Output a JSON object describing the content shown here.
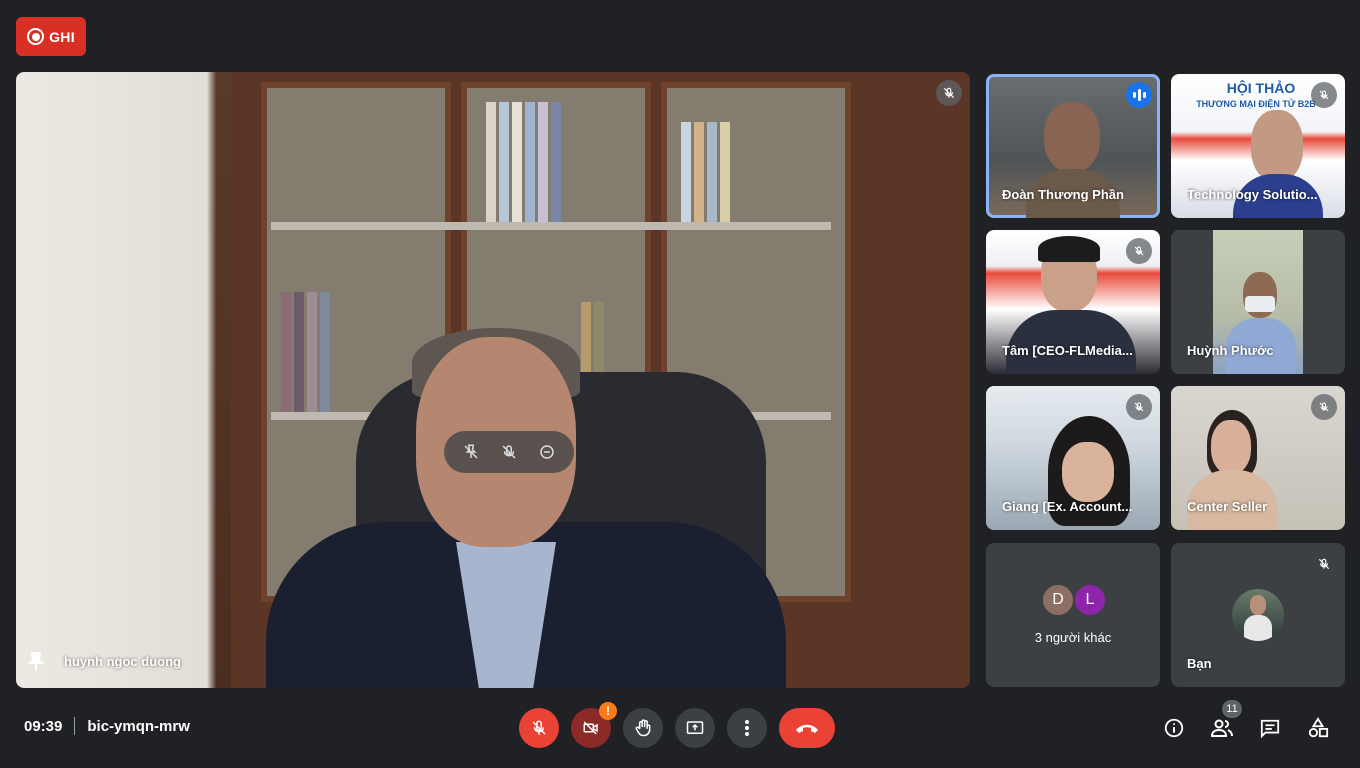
{
  "recording": {
    "label": "GHI",
    "color": "#d93025"
  },
  "main_tile": {
    "name": "huynh ngoc duong",
    "pinned": true,
    "muted": true
  },
  "participants": [
    {
      "name": "Đoàn Thương Phần",
      "speaking": true,
      "muted": false
    },
    {
      "name": "Technology Solutio...",
      "speaking": false,
      "muted": true,
      "banner_title": "HỘI THẢO",
      "banner_sub": "THƯƠNG MẠI ĐIỆN TỬ B2B"
    },
    {
      "name": "Tâm [CEO-FLMedia...",
      "speaking": false,
      "muted": true
    },
    {
      "name": "Huỳnh Phước",
      "speaking": false,
      "muted": false
    },
    {
      "name": "Giang [Ex. Account...",
      "speaking": false,
      "muted": true
    },
    {
      "name": "Center Seller",
      "speaking": false,
      "muted": true
    }
  ],
  "others": {
    "label": "3 người khác",
    "avatars": [
      {
        "letter": "D",
        "color": "#8d6e63"
      },
      {
        "letter": "L",
        "color": "#8e24aa"
      }
    ]
  },
  "self": {
    "name": "Bạn",
    "muted": true
  },
  "meeting": {
    "time": "09:39",
    "code": "bic-ymqn-mrw"
  },
  "toolbar": {
    "warning": "!",
    "people_count": "11"
  },
  "colors": {
    "background": "#202124",
    "tile": "#3c4043",
    "danger": "#ea4335",
    "accent": "#8ab4f8",
    "speaking": "#1a73e8"
  },
  "icons": [
    "record-icon",
    "mic-off-icon",
    "camera-off-icon",
    "hand-icon",
    "present-icon",
    "more-vert-icon",
    "hangup-icon",
    "info-icon",
    "people-icon",
    "chat-icon",
    "activities-icon",
    "pin-icon",
    "speaking-icon"
  ]
}
